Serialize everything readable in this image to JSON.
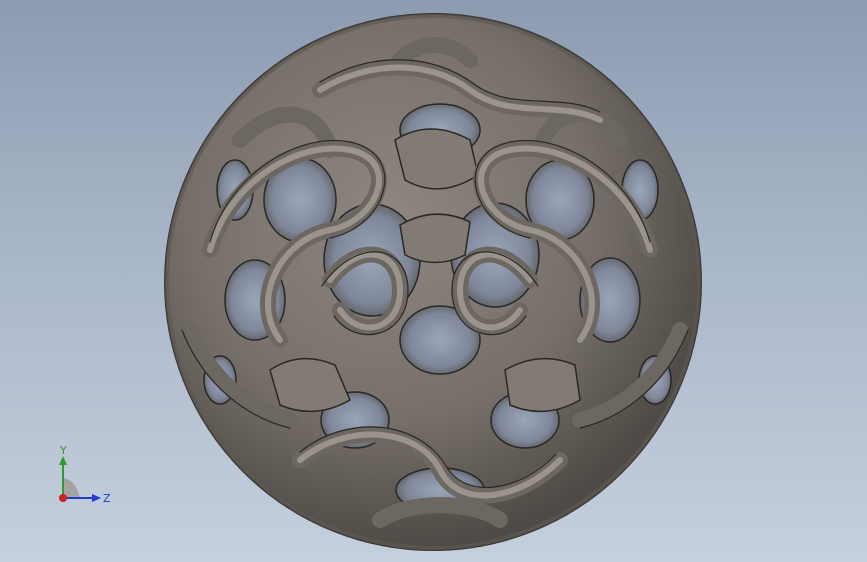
{
  "viewport": {
    "background_top": "#8d9bb1",
    "background_bottom": "#c5d0dd"
  },
  "model": {
    "name": "lattice-sphere",
    "shell_color": "#7c766f",
    "edge_color": "#2a2725"
  },
  "triad": {
    "y_label": "Y",
    "z_label": "Z",
    "y_color": "#2e9b2e",
    "z_color": "#1f3bd1",
    "origin_color": "#d12020"
  }
}
